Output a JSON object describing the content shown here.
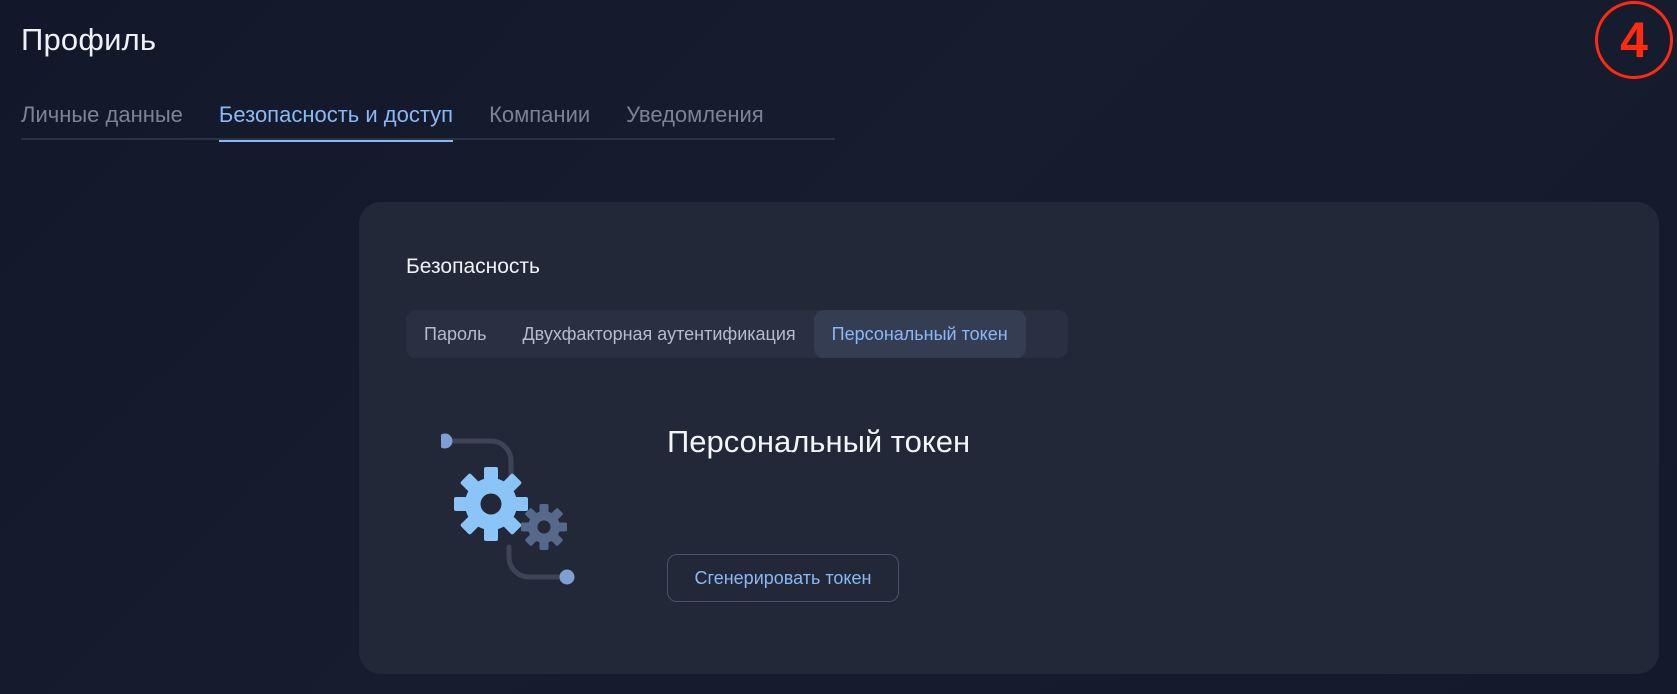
{
  "page": {
    "title": "Профиль"
  },
  "step_badge": {
    "number": "4",
    "color": "#ff2a0f"
  },
  "main_tabs": [
    {
      "label": "Личные данные",
      "active": false
    },
    {
      "label": "Безопасность и доступ",
      "active": true
    },
    {
      "label": "Компании",
      "active": false
    },
    {
      "label": "Уведомления",
      "active": false
    }
  ],
  "security": {
    "title": "Безопасность",
    "sub_tabs": [
      {
        "label": "Пароль",
        "active": false
      },
      {
        "label": "Двухфакторная аутентификация",
        "active": false
      },
      {
        "label": "Персональный токен",
        "active": true
      }
    ],
    "token": {
      "title": "Персональный токен",
      "illustration_icon": "gears-icon",
      "generate_button": "Сгенерировать токен"
    }
  },
  "colors": {
    "accent": "#8bb8f5",
    "background": "#141a2b",
    "card": "#222837",
    "badge": "#ff2a0f"
  }
}
